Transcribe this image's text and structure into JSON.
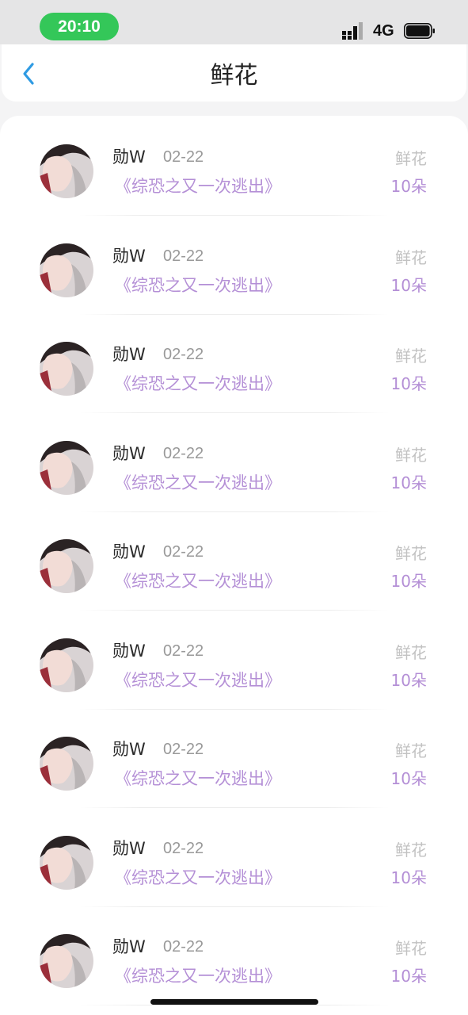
{
  "status_bar": {
    "time": "20:10",
    "network": "4G",
    "accent": "#34c759"
  },
  "nav": {
    "title": "鲜花"
  },
  "colors": {
    "purple": "#b48fd6",
    "gray": "#999999"
  },
  "records": [
    {
      "name": "勋W",
      "date": "02-22",
      "book": "《综恐之又一次逃出》",
      "type": "鲜花",
      "amount": "10朵"
    },
    {
      "name": "勋W",
      "date": "02-22",
      "book": "《综恐之又一次逃出》",
      "type": "鲜花",
      "amount": "10朵"
    },
    {
      "name": "勋W",
      "date": "02-22",
      "book": "《综恐之又一次逃出》",
      "type": "鲜花",
      "amount": "10朵"
    },
    {
      "name": "勋W",
      "date": "02-22",
      "book": "《综恐之又一次逃出》",
      "type": "鲜花",
      "amount": "10朵"
    },
    {
      "name": "勋W",
      "date": "02-22",
      "book": "《综恐之又一次逃出》",
      "type": "鲜花",
      "amount": "10朵"
    },
    {
      "name": "勋W",
      "date": "02-22",
      "book": "《综恐之又一次逃出》",
      "type": "鲜花",
      "amount": "10朵"
    },
    {
      "name": "勋W",
      "date": "02-22",
      "book": "《综恐之又一次逃出》",
      "type": "鲜花",
      "amount": "10朵"
    },
    {
      "name": "勋W",
      "date": "02-22",
      "book": "《综恐之又一次逃出》",
      "type": "鲜花",
      "amount": "10朵"
    },
    {
      "name": "勋W",
      "date": "02-22",
      "book": "《综恐之又一次逃出》",
      "type": "鲜花",
      "amount": "10朵"
    }
  ]
}
